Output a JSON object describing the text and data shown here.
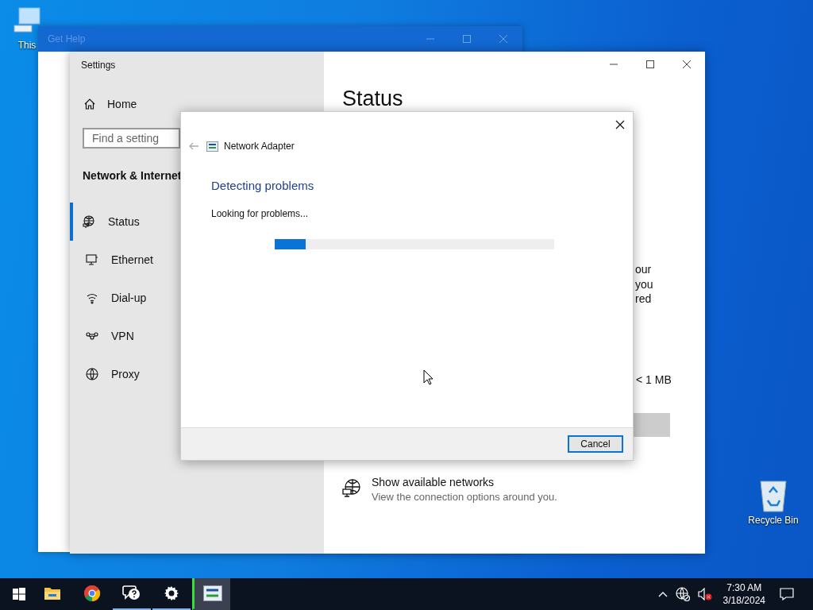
{
  "desktop_icons": [
    {
      "kind": "computer",
      "label": "This"
    },
    {
      "kind": "recycle_bin",
      "label": "Recycle Bin"
    }
  ],
  "get_help_window": {
    "title": "Get Help"
  },
  "settings_window": {
    "title": "Settings",
    "home": "Home",
    "search": {
      "placeholder": "Find a setting"
    },
    "section": "Network & Internet",
    "nav": [
      {
        "kind": "status",
        "label": "Status",
        "selected": true
      },
      {
        "kind": "ethernet",
        "label": "Ethernet",
        "selected": false
      },
      {
        "kind": "dialup",
        "label": "Dial-up",
        "selected": false
      },
      {
        "kind": "vpn",
        "label": "VPN",
        "selected": false
      },
      {
        "kind": "proxy",
        "label": "Proxy",
        "selected": false
      }
    ],
    "heading": "Status",
    "cut_lines": [
      "our",
      "you",
      "red"
    ],
    "data_usage": "< 1 MB",
    "link": {
      "title": "Show available networks",
      "description": "View the connection options around you."
    }
  },
  "dialog": {
    "app": "Network Adapter",
    "heading": "Detecting problems",
    "status": "Looking for problems...",
    "progress": {
      "level": 0.11
    },
    "button": "Cancel"
  },
  "taskbar": {
    "apps": [
      {
        "kind": "explorer",
        "running": false,
        "active": false
      },
      {
        "kind": "chrome",
        "running": false,
        "active": false
      },
      {
        "kind": "help",
        "running": true,
        "active": false
      },
      {
        "kind": "settings",
        "running": true,
        "active": false
      },
      {
        "kind": "adapter",
        "running": true,
        "active": true
      }
    ],
    "clock": {
      "time": "7:30 AM",
      "date": "3/18/2024"
    }
  }
}
